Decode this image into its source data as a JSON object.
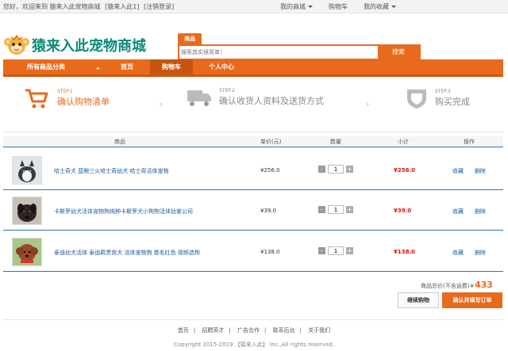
{
  "topbar": {
    "welcome": "您好，欢迎来到 猿来入此宠物商城",
    "user": "[猿来入此1]",
    "logout": "[注销登录]",
    "links": [
      {
        "label": "我的商城",
        "dropdown": true
      },
      {
        "label": "购物车",
        "dropdown": false
      },
      {
        "label": "我的收藏",
        "dropdown": true
      }
    ]
  },
  "logo": {
    "text": "猿来入此宠物商城"
  },
  "search": {
    "tab": "商品",
    "placeholder": "搜索其实很简单！",
    "button": "搜索"
  },
  "nav": {
    "category": "所有商品分类",
    "items": [
      "首页",
      "购物车",
      "个人中心"
    ],
    "active_index": 1
  },
  "steps": [
    {
      "num": "STEP.1",
      "label": "确认购物清单",
      "active": true,
      "icon": "cart-icon"
    },
    {
      "num": "STEP.2",
      "label": "确认收货人资料及送货方式",
      "active": false,
      "icon": "truck-icon"
    },
    {
      "num": "STEP.3",
      "label": "购买完成",
      "active": false,
      "icon": "shield-icon"
    }
  ],
  "table": {
    "headers": {
      "product": "商品",
      "price": "单价(元)",
      "qty": "数量",
      "subtotal": "小计",
      "action": "操作"
    },
    "rows": [
      {
        "name": "哈士奇犬 蓝眼三火哈士奇幼犬 哈士奇活体宠物",
        "price": "¥256.0",
        "qty": "1",
        "subtotal": "¥256.0",
        "fav": "收藏",
        "del": "删除"
      },
      {
        "name": "卡斯罗幼犬活体宠物狗纯种卡斯罗犬小狗狗活体幼崽公司",
        "price": "¥39.0",
        "qty": "1",
        "subtotal": "¥39.0",
        "fav": "收藏",
        "del": "删除"
      },
      {
        "name": "泰迪幼犬活体 泰迪羁贵宾犬 活体宠物狗 卷毛红色 视频选狗",
        "price": "¥138.0",
        "qty": "1",
        "subtotal": "¥138.0",
        "fav": "收藏",
        "del": "删除"
      }
    ]
  },
  "summary": {
    "label": "商品总价(不含运费)",
    "currency": "¥",
    "total": "433"
  },
  "buttons": {
    "continue": "继续购物",
    "checkout": "确认并填写订单"
  },
  "footer": {
    "links": [
      "首页",
      "招聘英才",
      "广告合作",
      "联系后台",
      "关于我们"
    ],
    "copyright": "Copyright 2015-2019 【猿来入此】 Inc.,All rights reserved."
  },
  "colors": {
    "accent": "#e86a1c",
    "link": "#1a5a9a",
    "price_red": "#dd1111",
    "divider_blue": "#2e73b8"
  }
}
